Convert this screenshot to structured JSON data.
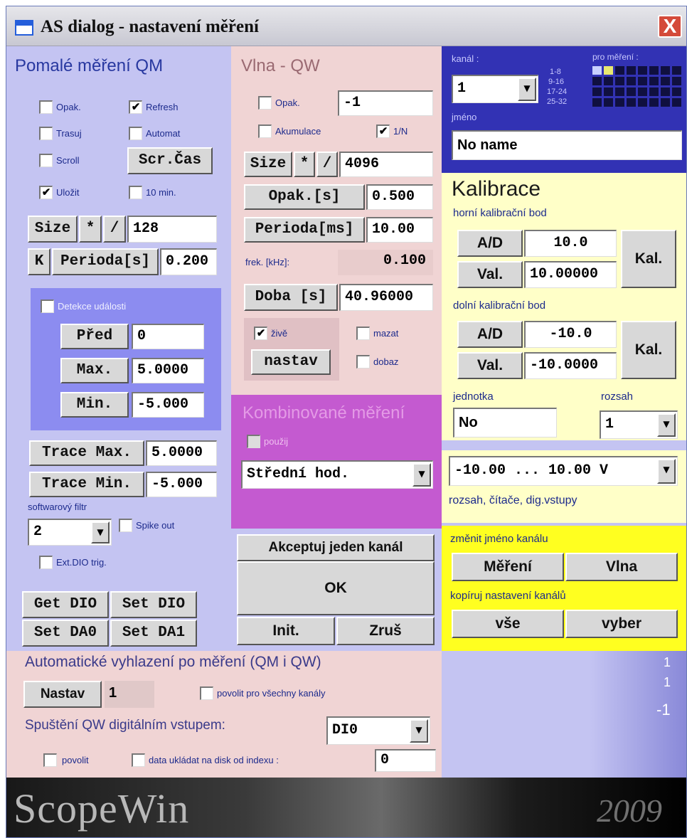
{
  "window": {
    "title": "AS dialog - nastavení měření",
    "close_label": "X"
  },
  "qm": {
    "title": "Pomalé měření QM",
    "checks": [
      {
        "label": "Opak.",
        "checked": false
      },
      {
        "label": "Refresh",
        "checked": true
      },
      {
        "label": "Trasuj",
        "checked": false
      },
      {
        "label": "Automat",
        "checked": false
      },
      {
        "label": "Scroll",
        "checked": false
      },
      {
        "label": "Uložit",
        "checked": true
      },
      {
        "label": "10 min.",
        "checked": false
      }
    ],
    "scrcas_label": "Scr.Čas",
    "size_label": "Size",
    "mul_label": "*",
    "div_label": "/",
    "size_value": "128",
    "k_label": "K",
    "perioda_label": "Perioda[s]",
    "perioda_value": "0.200",
    "detekce": {
      "check_label": "Detekce události",
      "checked": false,
      "pred_label": "Před",
      "pred_value": "0",
      "max_label": "Max.",
      "max_value": "5.0000",
      "min_label": "Min.",
      "min_value": "-5.000"
    },
    "trace_max_label": "Trace Max.",
    "trace_max_value": "5.0000",
    "trace_min_label": "Trace Min.",
    "trace_min_value": "-5.000",
    "filter_label": "softwarový filtr",
    "filter_value": "2",
    "spike_label": "Spike out",
    "spike_checked": false,
    "extdio_label": "Ext.DIO trig.",
    "extdio_checked": false
  },
  "dio": {
    "get_dio": "Get DIO",
    "set_dio": "Set DIO",
    "set_da0": "Set DA0",
    "set_da1": "Set DA1"
  },
  "qw": {
    "title": "Vlna - QW",
    "opak_label": "Opak.",
    "opak_checked": false,
    "opak_value": "-1",
    "akum_label": "Akumulace",
    "akum_checked": false,
    "n_label": "1/N",
    "n_checked": true,
    "size_label": "Size",
    "mul_label": "*",
    "div_label": "/",
    "size_value": "4096",
    "opaks_label": "Opak.[s]",
    "opaks_value": "0.500",
    "perioda_label": "Perioda[ms]",
    "perioda_value": "10.00",
    "frek_label": "frek. [kHz]:",
    "frek_value": "0.100",
    "doba_label": "Doba [s]",
    "doba_value": "40.96000",
    "zive_label": "živě",
    "zive_checked": true,
    "nastav_label": "nastav",
    "mazat_label": "mazat",
    "mazat_checked": false,
    "dobaz_label": "dobaz",
    "dobaz_checked": false
  },
  "komb": {
    "title": "Kombinované měření",
    "pouzij_label": "použij",
    "pouzij_checked": false,
    "select_value": "Střední hod."
  },
  "actions": {
    "akceptuj": "Akceptuj jeden kanál",
    "ok": "OK",
    "init": "Init.",
    "zrus": "Zruš"
  },
  "channel": {
    "kanal_label": "kanál :",
    "kanal_value": "1",
    "pro_mereni_label": "pro měření :",
    "grid_rows": [
      "1-8",
      "9-16",
      "17-24",
      "25-32"
    ],
    "jmeno_label": "jméno",
    "jmeno_value": "No name"
  },
  "kalibrace": {
    "title": "Kalibrace",
    "horni_label": "horní kalibrační bod",
    "ad_label": "A/D",
    "ad_hi": "10.0",
    "val_label": "Val.",
    "val_hi": "10.00000",
    "kal_label": "Kal.",
    "dolni_label": "dolní kalibrační bod",
    "ad_lo": "-10.0",
    "val_lo": "-10.0000",
    "jednotka_label": "jednotka",
    "jednotka_value": "No",
    "rozsah_label": "rozsah",
    "rozsah_value": "1"
  },
  "range": {
    "value": "-10.00 ... 10.00 V",
    "caption": "rozsah, čítače, dig.vstupy"
  },
  "rename": {
    "label": "změnit jméno kanálu",
    "mereni": "Měření",
    "vlna": "Vlna",
    "copy_label": "kopíruj nastavení kanálů",
    "vse": "vše",
    "vyber": "vyber"
  },
  "smooth": {
    "title": "Automatické vyhlazení po měření (QM i QW)",
    "nastav_label": "Nastav",
    "nastav_value": "1",
    "povolit_all_label": "povolit pro všechny kanály",
    "povolit_all_checked": false
  },
  "trigger": {
    "title": "Spuštění QW digitálním vstupem:",
    "select_value": "DI0",
    "povolit_label": "povolit",
    "povolit_checked": false,
    "data_label": "data ukládat na disk od indexu :",
    "data_checked": false,
    "index_value": "0"
  },
  "side_marks": [
    "1",
    "1",
    "-1"
  ],
  "footer": {
    "logo_text": "ScopeWin",
    "right_text": "2009"
  },
  "colors": {
    "qm_bg": "#c4c4f2",
    "qw_bg": "#f0d4d4",
    "komb_bg": "#c45ad0",
    "chan_bg": "#3232b4",
    "kal_bg": "#ffffc8",
    "rename_bg": "#ffff20",
    "smooth_bg": "#f0d4d4"
  }
}
